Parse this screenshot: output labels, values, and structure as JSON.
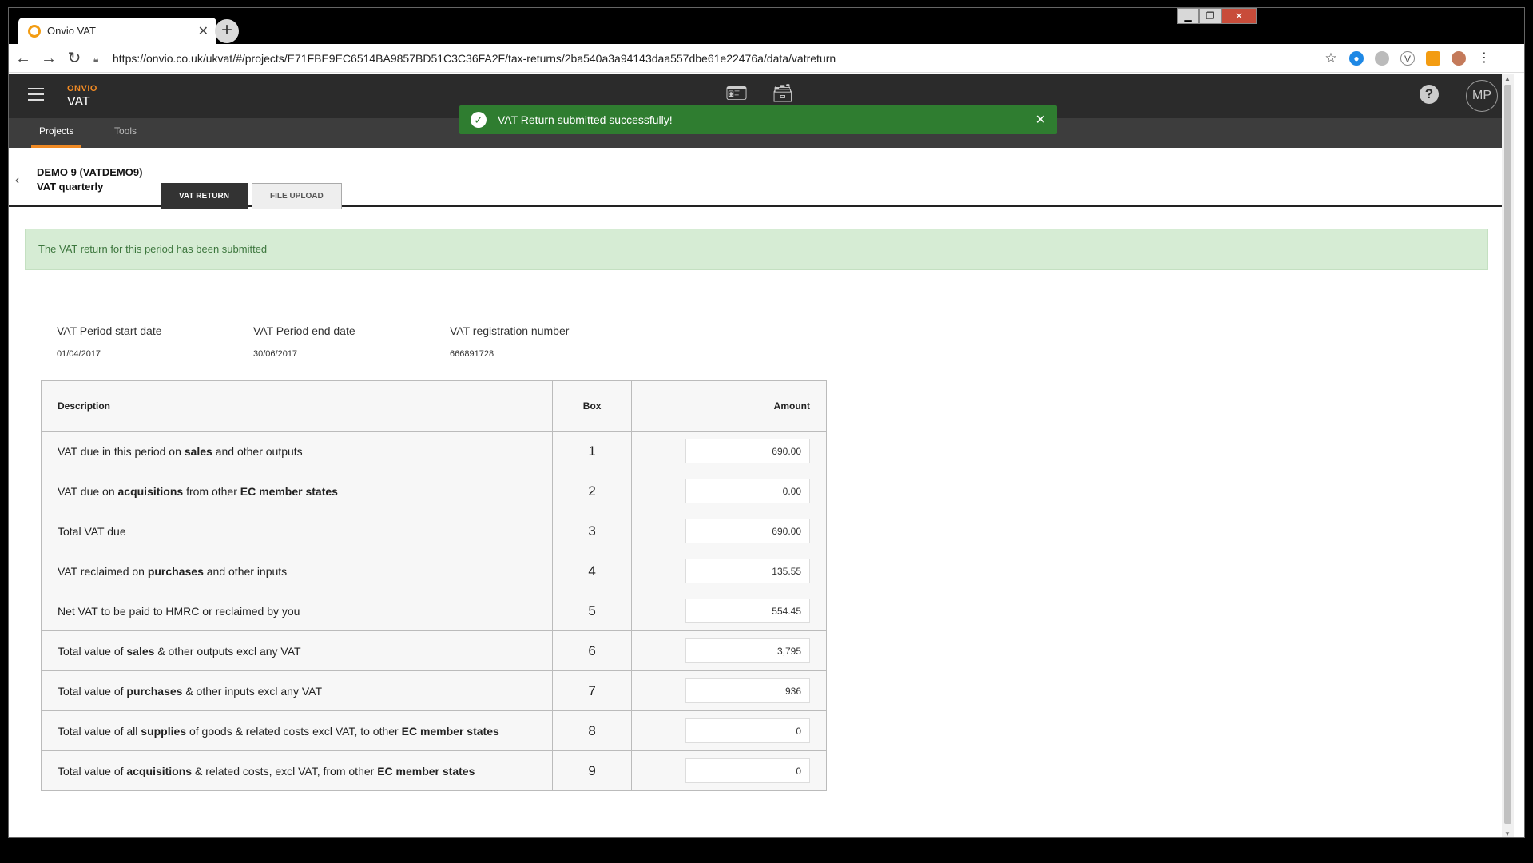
{
  "browser": {
    "tab_title": "Onvio VAT",
    "url": "https://onvio.co.uk/ukvat/#/projects/E71FBE9EC6514BA9857BD51C3C36FA2F/tax-returns/2ba540a3a94143daa557dbe61e22476a/data/vatreturn"
  },
  "app": {
    "brand_top": "ONVIO",
    "brand_name": "VAT",
    "user_initials": "MP",
    "help_label": "?",
    "nav": {
      "projects": "Projects",
      "tools": "Tools"
    }
  },
  "toast": {
    "message": "VAT Return submitted successfully!"
  },
  "project": {
    "name": "DEMO 9 (VATDEMO9)",
    "type": "VAT quarterly",
    "tabs": {
      "vat_return": "VAT RETURN",
      "file_upload": "FILE UPLOAD"
    }
  },
  "banner": "The VAT return for this period has been submitted",
  "meta": {
    "start_label": "VAT Period start date",
    "start_value": "01/04/2017",
    "end_label": "VAT Period end date",
    "end_value": "30/06/2017",
    "reg_label": "VAT registration number",
    "reg_value": "666891728"
  },
  "table": {
    "headers": {
      "description": "Description",
      "box": "Box",
      "amount": "Amount"
    },
    "rows": [
      {
        "box": "1",
        "amount": "690.00",
        "desc": [
          [
            "VAT due in this period on ",
            false
          ],
          [
            "sales",
            true
          ],
          [
            " and other outputs",
            false
          ]
        ]
      },
      {
        "box": "2",
        "amount": "0.00",
        "desc": [
          [
            "VAT due on ",
            false
          ],
          [
            "acquisitions",
            true
          ],
          [
            " from other ",
            false
          ],
          [
            "EC member states",
            true
          ]
        ]
      },
      {
        "box": "3",
        "amount": "690.00",
        "desc": [
          [
            "Total VAT due",
            false
          ]
        ]
      },
      {
        "box": "4",
        "amount": "135.55",
        "desc": [
          [
            "VAT reclaimed on ",
            false
          ],
          [
            "purchases",
            true
          ],
          [
            " and other inputs",
            false
          ]
        ]
      },
      {
        "box": "5",
        "amount": "554.45",
        "desc": [
          [
            "Net VAT to be paid to HMRC or reclaimed by you",
            false
          ]
        ]
      },
      {
        "box": "6",
        "amount": "3,795",
        "desc": [
          [
            "Total value of ",
            false
          ],
          [
            "sales",
            true
          ],
          [
            " & other outputs excl any VAT",
            false
          ]
        ]
      },
      {
        "box": "7",
        "amount": "936",
        "desc": [
          [
            "Total value of ",
            false
          ],
          [
            "purchases",
            true
          ],
          [
            " & other inputs excl any VAT",
            false
          ]
        ]
      },
      {
        "box": "8",
        "amount": "0",
        "desc": [
          [
            "Total value of all ",
            false
          ],
          [
            "supplies",
            true
          ],
          [
            " of goods & related costs excl VAT, to other ",
            false
          ],
          [
            "EC member states",
            true
          ]
        ]
      },
      {
        "box": "9",
        "amount": "0",
        "desc": [
          [
            "Total value of ",
            false
          ],
          [
            "acquisitions",
            true
          ],
          [
            " & related costs, excl VAT, from other ",
            false
          ],
          [
            "EC member states",
            true
          ]
        ]
      }
    ]
  },
  "colors": {
    "accent": "#f08a24",
    "success": "#2f7d30",
    "banner_bg": "#d6ecd4",
    "appbar": "#2b2b2b"
  },
  "icons": [
    "back-arrow-icon",
    "forward-arrow-icon",
    "reload-icon",
    "lock-icon",
    "star-icon",
    "hamburger-icon",
    "id-card-icon",
    "archive-icon",
    "help-icon",
    "check-circle-icon",
    "close-icon",
    "chevron-left-icon"
  ]
}
